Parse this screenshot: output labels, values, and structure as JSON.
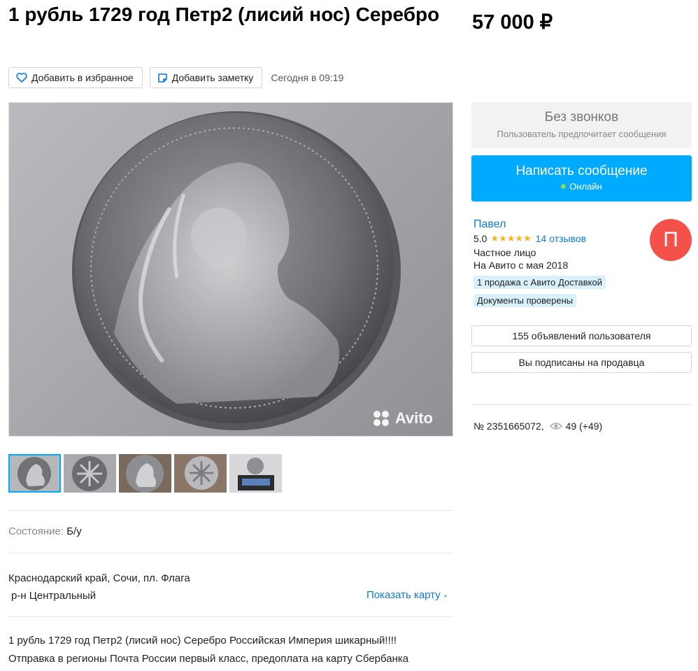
{
  "listing": {
    "title": "1 рубль 1729 год Петр2 (лисий нос) Серебро",
    "price": "57 000 ₽",
    "favorite_label": "Добавить в избранное",
    "note_label": "Добавить заметку",
    "posted": "Сегодня в 09:19",
    "watermark": "Avito"
  },
  "thumbnails": [
    "thumb-1",
    "thumb-2",
    "thumb-3",
    "thumb-4",
    "thumb-5"
  ],
  "params": {
    "condition_key": "Состояние:",
    "condition_value": "Б/у"
  },
  "address": {
    "line1": "Краснодарский край, Сочи, пл. Флага",
    "line2": "р-н Центральный",
    "map_link": "Показать карту"
  },
  "description": {
    "line1": "1 рубль 1729 год Петр2 (лисий нос) Серебро Российская Империя шикарный!!!!",
    "line2": "Отправка в регионы Почта России первый класс, предоплата на карту Сбербанка"
  },
  "contact": {
    "no_calls_title": "Без звонков",
    "no_calls_sub": "Пользователь предпочитает сообщения",
    "message_button": "Написать сообщение",
    "online": "Онлайн"
  },
  "seller": {
    "name": "Павел",
    "rating": "5.0",
    "stars": "★★★★★",
    "reviews": "14 отзывов",
    "type": "Частное лицо",
    "since": "На Авито с мая 2018",
    "badge_delivery": "1 продажа с Авито Доставкой",
    "badge_docs": "Документы проверены",
    "avatar_letter": "П",
    "listings_button": "155 объявлений пользователя",
    "subscribed_button": "Вы подписаны на продавца"
  },
  "meta": {
    "ad_number": "№ 2351665072,",
    "views": "49 (+49)"
  },
  "colors": {
    "accent": "#00aaff",
    "link": "#0a7ad6",
    "avatar": "#f4514b",
    "star": "#ffb021",
    "badge": "#d8f1fd"
  }
}
